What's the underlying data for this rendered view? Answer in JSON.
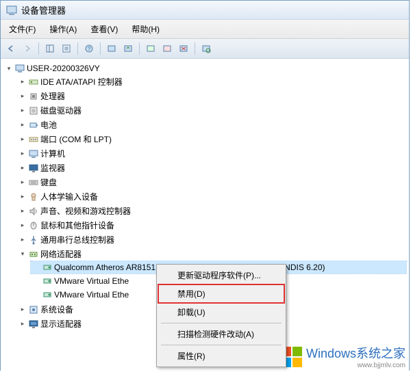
{
  "window": {
    "title": "设备管理器"
  },
  "menu": {
    "file": "文件(F)",
    "action": "操作(A)",
    "view": "查看(V)",
    "help": "帮助(H)"
  },
  "root": {
    "label": "USER-20200326VY"
  },
  "devices": [
    {
      "label": "IDE ATA/ATAPI 控制器",
      "icon": "controller"
    },
    {
      "label": "处理器",
      "icon": "cpu"
    },
    {
      "label": "磁盘驱动器",
      "icon": "disk"
    },
    {
      "label": "电池",
      "icon": "battery"
    },
    {
      "label": "端口 (COM 和 LPT)",
      "icon": "port"
    },
    {
      "label": "计算机",
      "icon": "computer"
    },
    {
      "label": "监视器",
      "icon": "monitor"
    },
    {
      "label": "键盘",
      "icon": "keyboard"
    },
    {
      "label": "人体学输入设备",
      "icon": "hid"
    },
    {
      "label": "声音、视频和游戏控制器",
      "icon": "sound"
    },
    {
      "label": "鼠标和其他指针设备",
      "icon": "mouse"
    },
    {
      "label": "通用串行总线控制器",
      "icon": "usb"
    }
  ],
  "network": {
    "label": "网络适配器",
    "items": [
      "Qualcomm Atheros AR8151 PCI-E Gigabit Ethernet Controller (NDIS 6.20)",
      "VMware Virtual Ethe",
      "VMware Virtual Ethe"
    ]
  },
  "tail": [
    {
      "label": "系统设备",
      "icon": "system"
    },
    {
      "label": "显示适配器",
      "icon": "display"
    }
  ],
  "ctx": {
    "update": "更新驱动程序软件(P)...",
    "disable": "禁用(D)",
    "uninstall": "卸载(U)",
    "scan": "扫描检测硬件改动(A)",
    "props": "属性(R)"
  },
  "watermark": {
    "text": "Windows系统之家",
    "url": "www.bjjmlv.com"
  },
  "logo_colors": {
    "tl": "#f25022",
    "tr": "#7fba00",
    "bl": "#00a4ef",
    "br": "#ffb900"
  }
}
